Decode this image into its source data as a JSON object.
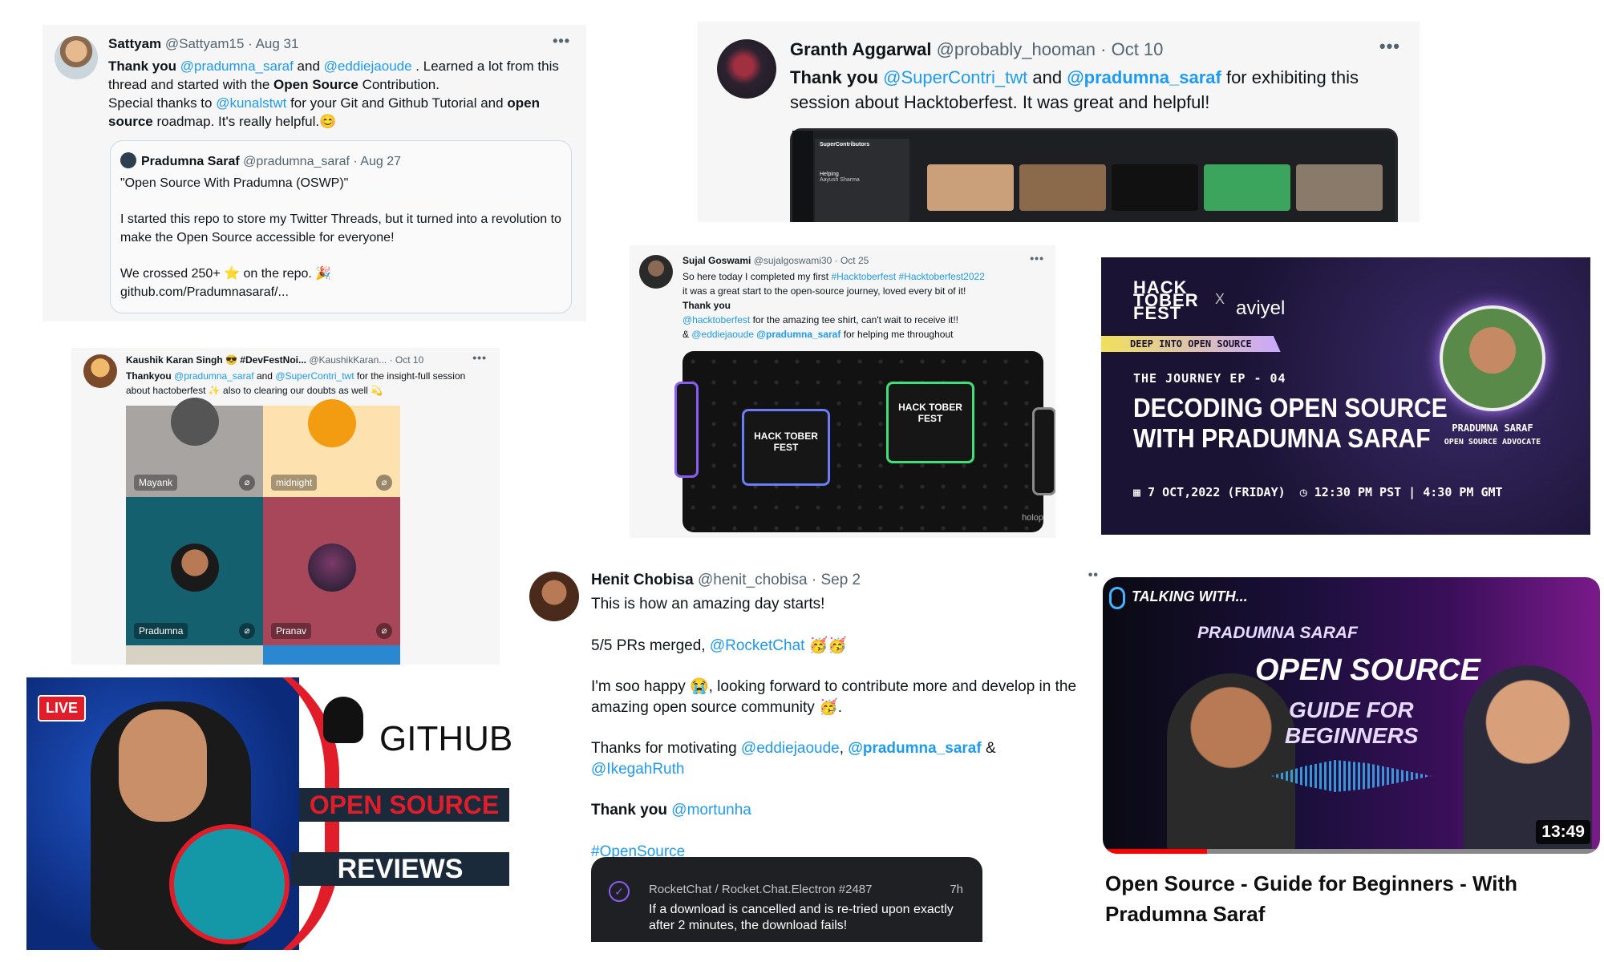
{
  "tweet1": {
    "name": "Sattyam",
    "handle": "@Sattyam15",
    "date": "· Aug 31",
    "text_1": "Thank you",
    "mention_1": "@pradumna_saraf",
    "text_2": "and",
    "mention_2": "@eddiejaoude",
    "text_3": ". Learned a lot from this thread and started with the",
    "bold_1": "Open Source",
    "text_4": "Contribution.",
    "text_5": "Special thanks to",
    "mention_3": "@kunalstwt",
    "text_6": "for your Git and Github Tutorial and",
    "bold_2": "open source",
    "text_7": "roadmap. It's really helpful.😊",
    "quote": {
      "name": "Pradumna Saraf",
      "handle": "@pradumna_saraf",
      "date": "· Aug 27",
      "line_1": "\"Open Source With Pradumna (OSWP)\"",
      "line_2": "I started this repo to store my Twitter Threads, but it turned into a revolution to make the Open Source accessible for everyone!",
      "line_3": "We crossed 250+ ⭐ on the repo. 🎉",
      "line_4": "github.com/Pradumnasaraf/..."
    }
  },
  "tweet2": {
    "name": "Granth Aggarwal",
    "handle": "@probably_hooman",
    "date": "· Oct 10",
    "text_1": "Thank you",
    "mention_1": "@SuperContri_twt",
    "text_2": "and",
    "mention_2": "@pradumna_saraf",
    "text_3": "for exhibiting this session about Hacktoberfest. It was great and helpful!",
    "server": "SuperContributors",
    "channel": "Helping",
    "user": "Aayush Sharma"
  },
  "tweet3": {
    "name": "Kaushik Karan Singh 😎 #DevFestNoi...",
    "handle": "@KaushikKaran...",
    "date": "· Oct 10",
    "text_1": "Thankyou",
    "mention_1": "@pradumna_saraf",
    "text_2": "and",
    "mention_2": "@SuperContri_twt",
    "text_3": "for the insight-full session about hactoberfest ✨ also to clearing our doubts as well 💫",
    "participants": [
      "Mayank",
      "midnight",
      "Pradumna",
      "Pranav"
    ]
  },
  "github_thumb": {
    "live": "LIVE",
    "brand": "GITHUB",
    "line_1": "OPEN SOURCE",
    "line_2": "REVIEWS"
  },
  "tweet4": {
    "name": "Sujal Goswami",
    "handle": "@sujalgoswami30",
    "date": "· Oct 25",
    "text_1": "So here today I completed my first",
    "tag_1": "#Hacktoberfest #Hacktoberfest2022",
    "text_2": "it was a great start to the open-source journey, loved every bit of it!",
    "bold_1": "Thank you",
    "mention_1": "@hacktoberfest",
    "text_3": "for the amazing tee shirt, can't wait to receive it!!",
    "text_4": "&",
    "mention_2": "@eddiejaoude",
    "mention_3": "@pradumna_saraf",
    "text_5": "for helping me throughout",
    "badge_1": "HACK TOBER FEST",
    "badge_2": "HACK TOBER FEST",
    "badge_3": "holop"
  },
  "banner": {
    "brand_1": "HACK TOBER FEST",
    "x": "X",
    "brand_2": "aviyel",
    "tag": "DEEP INTO OPEN SOURCE",
    "episode": "THE JOURNEY EP - 04",
    "title_1": "DECODING OPEN SOURCE",
    "title_2": "WITH PRADUMNA SARAF",
    "person": "PRADUMNA SARAF",
    "role": "OPEN SOURCE ADVOCATE",
    "date": "7 OCT,2022 (FRIDAY)",
    "time": "12:30 PM PST | 4:30 PM GMT"
  },
  "tweet5": {
    "name": "Henit Chobisa",
    "handle": "@henit_chobisa",
    "date": "· Sep 2",
    "p1": "This is how an amazing day starts!",
    "p2_text": "5/5 PRs merged,",
    "p2_mention": "@RocketChat",
    "p2_emoji": "🥳🥳",
    "p3": "I'm soo happy 😭, looking forward to contribute more and develop in the amazing open source community 🥳.",
    "p4_text": "Thanks for motivating",
    "p4_m1": "@eddiejaoude",
    "p4_comma": ",",
    "p4_m2": "@pradumna_saraf",
    "p4_amp": "&",
    "p4_m3": "@IkegahRuth",
    "p5_bold": "Thank you",
    "p5_mention": "@mortunha",
    "p6": "#OpenSource",
    "pr_repo": "RocketChat / Rocket.Chat.Electron #2487",
    "pr_time": "7h",
    "pr_title": "If a download is cancelled and is re-tried upon exactly after 2 minutes, the download fails!"
  },
  "video": {
    "talking": "TALKING WITH...",
    "name": "PRADUMNA SARAF",
    "headline": "OPEN SOURCE",
    "sub_1": "GUIDE FOR",
    "sub_2": "BEGINNERS",
    "duration": "13:49",
    "progress": 0.21,
    "title": "Open Source - Guide for Beginners - With Pradumna Saraf"
  }
}
